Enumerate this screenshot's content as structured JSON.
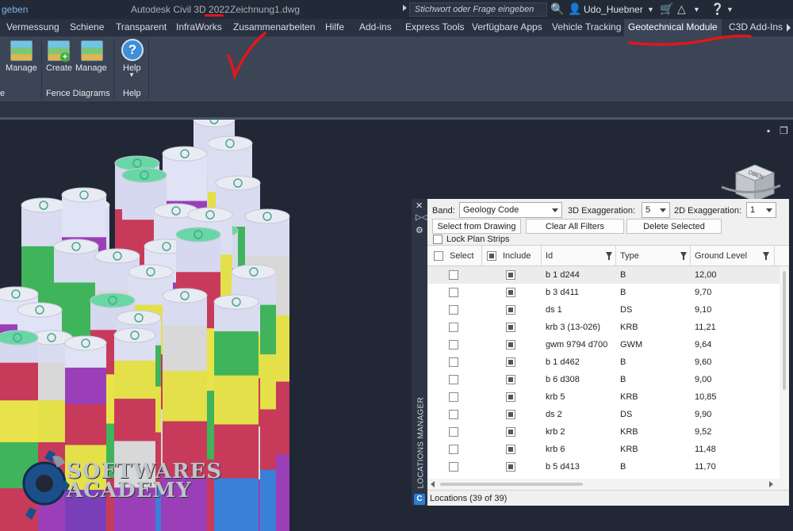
{
  "titlebar": {
    "left_cut": "geben",
    "app_title": "Autodesk Civil 3D 2022",
    "doc_title": "Zeichnung1.dwg",
    "search_placeholder": "Stichwort oder Frage eingeben",
    "user": "Udo_Huebner"
  },
  "tabs": [
    {
      "label": "Vermessung"
    },
    {
      "label": "Schiene"
    },
    {
      "label": "Transparent"
    },
    {
      "label": "InfraWorks"
    },
    {
      "label": "Zusammenarbeiten"
    },
    {
      "label": "Hilfe"
    },
    {
      "label": "Add-ins"
    },
    {
      "label": "Express Tools"
    },
    {
      "label": "Verfügbare Apps"
    },
    {
      "label": "Vehicle Tracking"
    },
    {
      "label": "Geotechnical Module"
    },
    {
      "label": "C3D Add-Ins"
    }
  ],
  "ribbon": {
    "btn_manage_left": "Manage",
    "btn_create": "Create",
    "btn_manage": "Manage",
    "btn_help": "Help",
    "group_left_cut": "e",
    "group_fence": "Fence Diagrams",
    "group_help": "Help"
  },
  "viewcube": {
    "face_label": "OBEN"
  },
  "locations_manager": {
    "title": "LOCATIONS MANAGER",
    "band_label": "Band:",
    "band_value": "Geology Code",
    "exag3d_label": "3D Exaggeration:",
    "exag3d_value": "5",
    "exag2d_label": "2D Exaggeration:",
    "exag2d_value": "1",
    "select_from_drawing": "Select from Drawing",
    "clear_all_filters": "Clear All Filters",
    "delete_selected": "Delete Selected",
    "lock_plan_strips": "Lock Plan Strips",
    "columns": {
      "select": "Select",
      "include": "Include",
      "id": "Id",
      "type": "Type",
      "ground_level": "Ground Level"
    },
    "rows": [
      {
        "id": "b 1 d244",
        "type": "B",
        "ground": "12,00"
      },
      {
        "id": "b 3 d411",
        "type": "B",
        "ground": "9,70"
      },
      {
        "id": "ds 1",
        "type": "DS",
        "ground": "9,10"
      },
      {
        "id": "krb 3 (13-026)",
        "type": "KRB",
        "ground": "11,21"
      },
      {
        "id": "gwm 9794 d700",
        "type": "GWM",
        "ground": "9,64"
      },
      {
        "id": "b 1 d462",
        "type": "B",
        "ground": "9,60"
      },
      {
        "id": "b 6 d308",
        "type": "B",
        "ground": "9,00"
      },
      {
        "id": "krb 5",
        "type": "KRB",
        "ground": "10,85"
      },
      {
        "id": "ds 2",
        "type": "DS",
        "ground": "9,90"
      },
      {
        "id": "krb 2",
        "type": "KRB",
        "ground": "9,52"
      },
      {
        "id": "krb 6",
        "type": "KRB",
        "ground": "11,48"
      },
      {
        "id": "b 5 d413",
        "type": "B",
        "ground": "11,70"
      }
    ],
    "status": "Locations (39 of 39)"
  },
  "watermark": {
    "line1": "SOFTWARES",
    "line2": "ACADEMY"
  },
  "colors": {
    "annotation_red": "#e2171b",
    "ribbon_bg": "#3b4556",
    "panel_bg": "#ffffff"
  }
}
